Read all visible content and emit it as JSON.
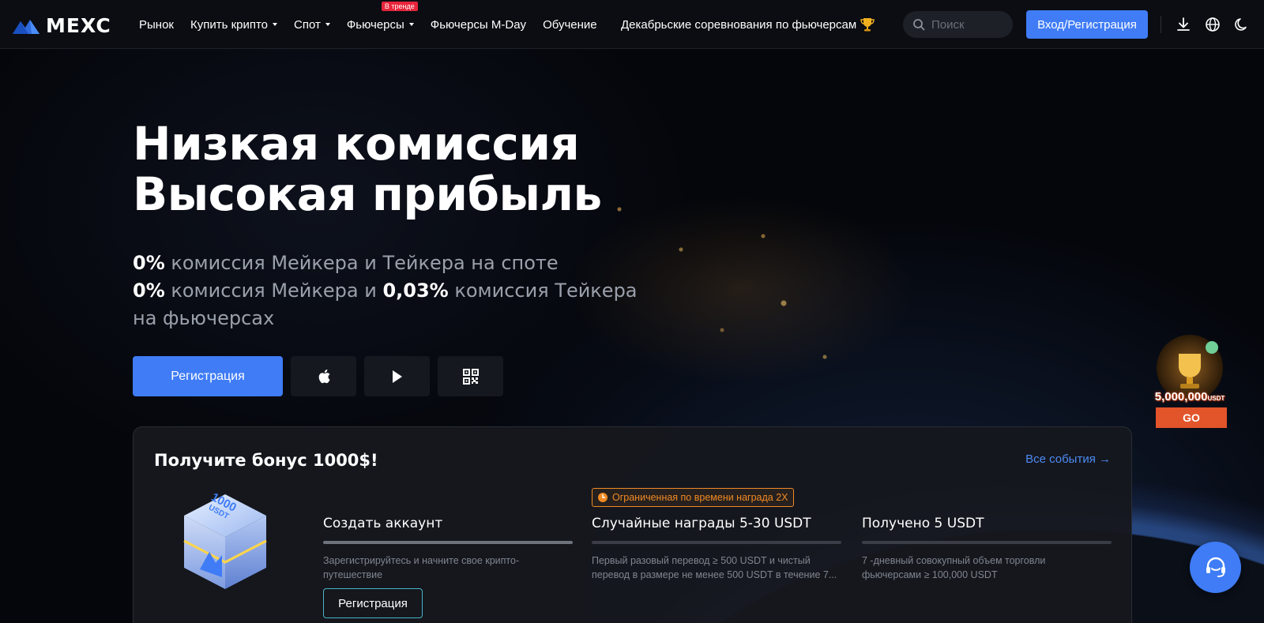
{
  "brand": {
    "name": "MEXC",
    "accent": "#3f7cf6"
  },
  "nav": {
    "items": [
      {
        "label": "Рынок",
        "dropdown": false
      },
      {
        "label": "Купить крипто",
        "dropdown": true
      },
      {
        "label": "Спот",
        "dropdown": true
      },
      {
        "label": "Фьючерсы",
        "dropdown": true,
        "badge": "В тренде"
      },
      {
        "label": "Фьючерсы M-Day",
        "dropdown": false
      },
      {
        "label": "Обучение",
        "dropdown": false
      }
    ],
    "promo": "Декабрьские соревнования по фьючерсам",
    "search_placeholder": "Поиск",
    "login_label": "Вход/Регистрация",
    "icons": [
      "download-icon",
      "globe-icon",
      "moon-icon"
    ]
  },
  "hero": {
    "title_line1": "Низкая комиссия",
    "title_line2": "Высокая прибыль",
    "sub1_bold": "0%",
    "sub1_text": " комиссия Мейкера и Тейкера на споте",
    "sub2_bold": "0%",
    "sub2_text1": " комиссия Мейкера и ",
    "sub2_bold2": "0,03%",
    "sub2_text2": " комиссия Тейкера на фьючерсах",
    "register_label": "Регистрация",
    "app_icons": [
      "apple-icon",
      "google-play-icon",
      "qr-code-icon"
    ]
  },
  "bonus": {
    "title": "Получите бонус 1000$!",
    "all_events": "Все события →",
    "cube_text_amount": "1000",
    "cube_text_unit": "USDT",
    "limited_badge": "Ограниченная по времени награда 2X",
    "steps": [
      {
        "title": "Создать аккаунт",
        "desc": "Зарегистрируйтесь и начните свое крипто-путешествие",
        "button": "Регистрация"
      },
      {
        "title": "Случайные награды 5-30 USDT",
        "desc": "Первый разовый перевод ≥ 500 USDT и чистый перевод в размере не менее 500 USDT в течение 7..."
      },
      {
        "title": "Получено 5 USDT",
        "desc": "7 -дневный совокупный объем торговли фьючерсами ≥ 100,000 USDT"
      }
    ]
  },
  "prize_widget": {
    "amount": "5,000,000",
    "unit": "USDT",
    "go": "GO"
  }
}
